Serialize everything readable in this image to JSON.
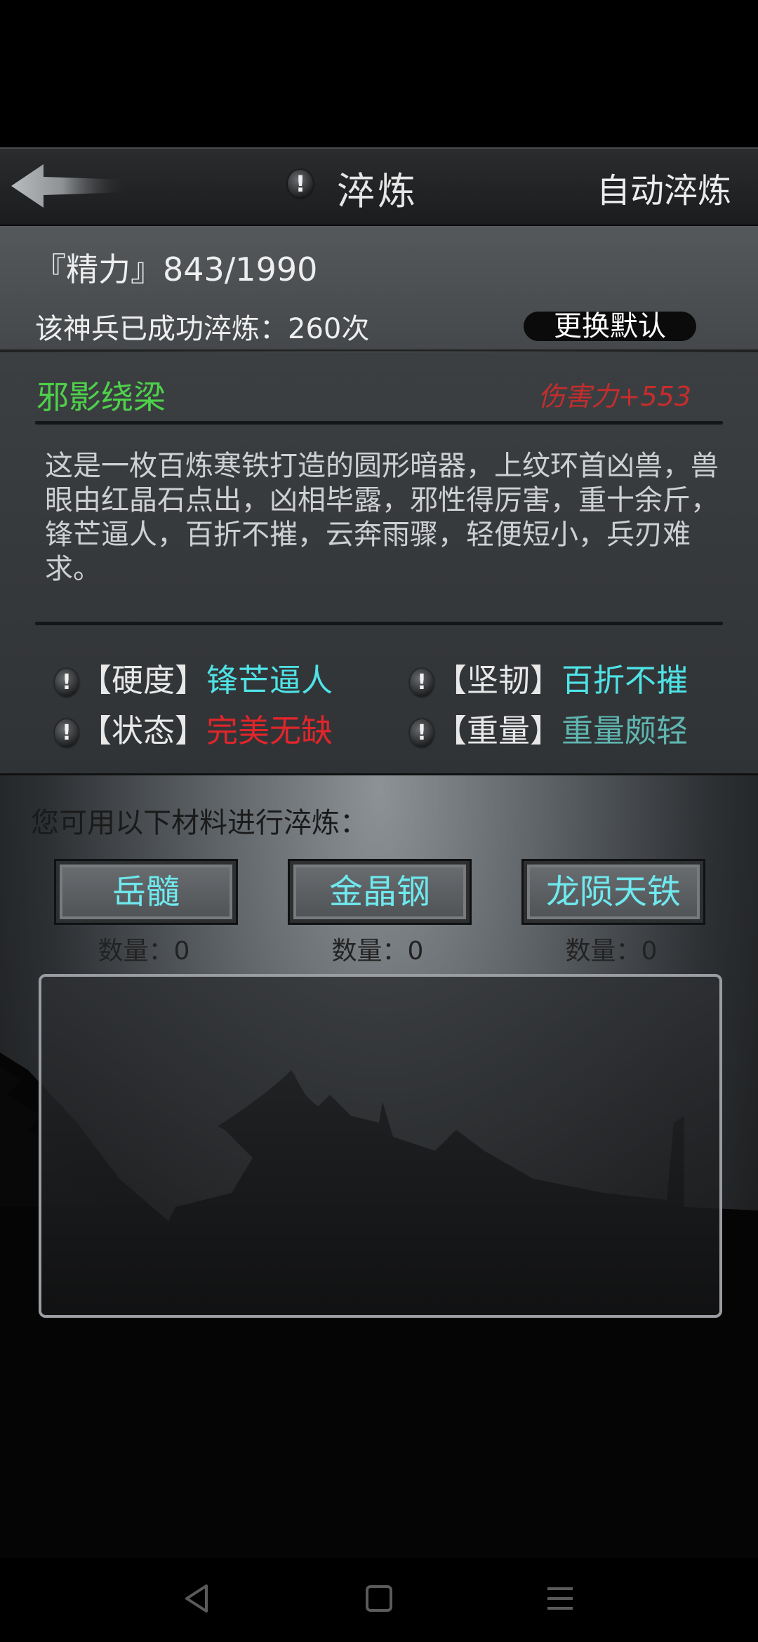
{
  "header": {
    "title": "淬炼",
    "info_glyph": "!",
    "auto_refine_label": "自动淬炼",
    "back_icon": "back-arrow-icon"
  },
  "status": {
    "energy_text": "『精力』843/1990",
    "refine_count_text": "该神兵已成功淬炼：260次",
    "switch_default_label": "更换默认"
  },
  "weapon": {
    "name": "邪影绕梁",
    "damage": "伤害力+553",
    "description": "这是一枚百炼寒铁打造的圆形暗器，上纹环首凶兽，兽眼由红晶石点出，凶相毕露，邪性得厉害，重十余斤，锋芒逼人，百折不摧，云奔雨骤，轻便短小，兵刃难求。",
    "attributes": [
      {
        "label": "【硬度】",
        "value": "锋芒逼人",
        "color": "#4fe3e6"
      },
      {
        "label": "【坚韧】",
        "value": "百折不摧",
        "color": "#4fe3e6"
      },
      {
        "label": "【状态】",
        "value": "完美无缺",
        "color": "#e0262a"
      },
      {
        "label": "【重量】",
        "value": "重量颇轻",
        "color": "#5fb6b0"
      }
    ]
  },
  "materials": {
    "prompt": "您可用以下材料进行淬炼：",
    "items": [
      {
        "name": "岳髓",
        "qty": "数量：0"
      },
      {
        "name": "金晶钢",
        "qty": "数量：0"
      },
      {
        "name": "龙陨天铁",
        "qty": "数量：0"
      }
    ]
  },
  "colors": {
    "weapon_name": "#4ed14a",
    "damage": "#c52d2d",
    "material_text": "#6fe9ee"
  },
  "navbar": {
    "icons": [
      "back-triangle-icon",
      "home-square-icon",
      "menu-lines-icon"
    ]
  }
}
